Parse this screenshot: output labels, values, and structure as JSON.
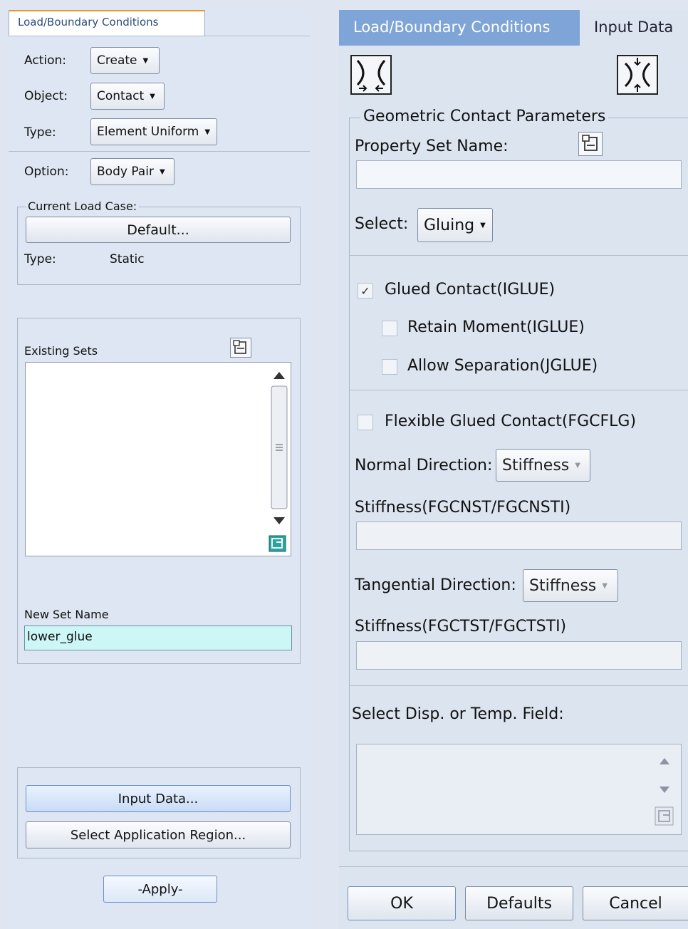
{
  "left": {
    "tab": "Load/Boundary Conditions",
    "action": {
      "label": "Action:",
      "value": "Create"
    },
    "object": {
      "label": "Object:",
      "value": "Contact"
    },
    "type": {
      "label": "Type:",
      "value": "Element Uniform"
    },
    "option": {
      "label": "Option:",
      "value": "Body Pair"
    },
    "load_case": {
      "legend": "Current Load Case:",
      "button": "Default...",
      "type_label": "Type:",
      "type_value": "Static"
    },
    "existing_sets_label": "Existing Sets",
    "new_set_label": "New Set Name",
    "new_set_value": "lower_glue",
    "input_data_button": "Input Data...",
    "select_region_button": "Select Application Region...",
    "apply_button": "-Apply-"
  },
  "right": {
    "tabs": [
      "Load/Boundary Conditions",
      "Input Data"
    ],
    "group_title": "Geometric Contact Parameters",
    "property_set_label": "Property Set Name:",
    "property_set_value": "",
    "select_label": "Select:",
    "select_value": "Gluing",
    "glued_contact": {
      "label": "Glued Contact(IGLUE)",
      "checked": true
    },
    "retain_moment": {
      "label": "Retain Moment(IGLUE)",
      "checked": false
    },
    "allow_separation": {
      "label": "Allow Separation(JGLUE)",
      "checked": false
    },
    "flexible_glued": {
      "label": "Flexible Glued Contact(FGCFLG)",
      "checked": false
    },
    "normal_direction": {
      "label": "Normal Direction:",
      "value": "Stiffness"
    },
    "normal_stiffness_label": "Stiffness(FGCNST/FGCNSTI)",
    "tangential_direction": {
      "label": "Tangential Direction:",
      "value": "Stiffness"
    },
    "tangential_stiffness_label": "Stiffness(FGCTST/FGCTSTI)",
    "disp_field_label": "Select Disp. or Temp. Field:",
    "ok_button": "OK",
    "defaults_button": "Defaults",
    "cancel_button": "Cancel"
  },
  "colors": {
    "input_highlight": "#ccf7f6",
    "tab_active": "#7fa4d7"
  }
}
